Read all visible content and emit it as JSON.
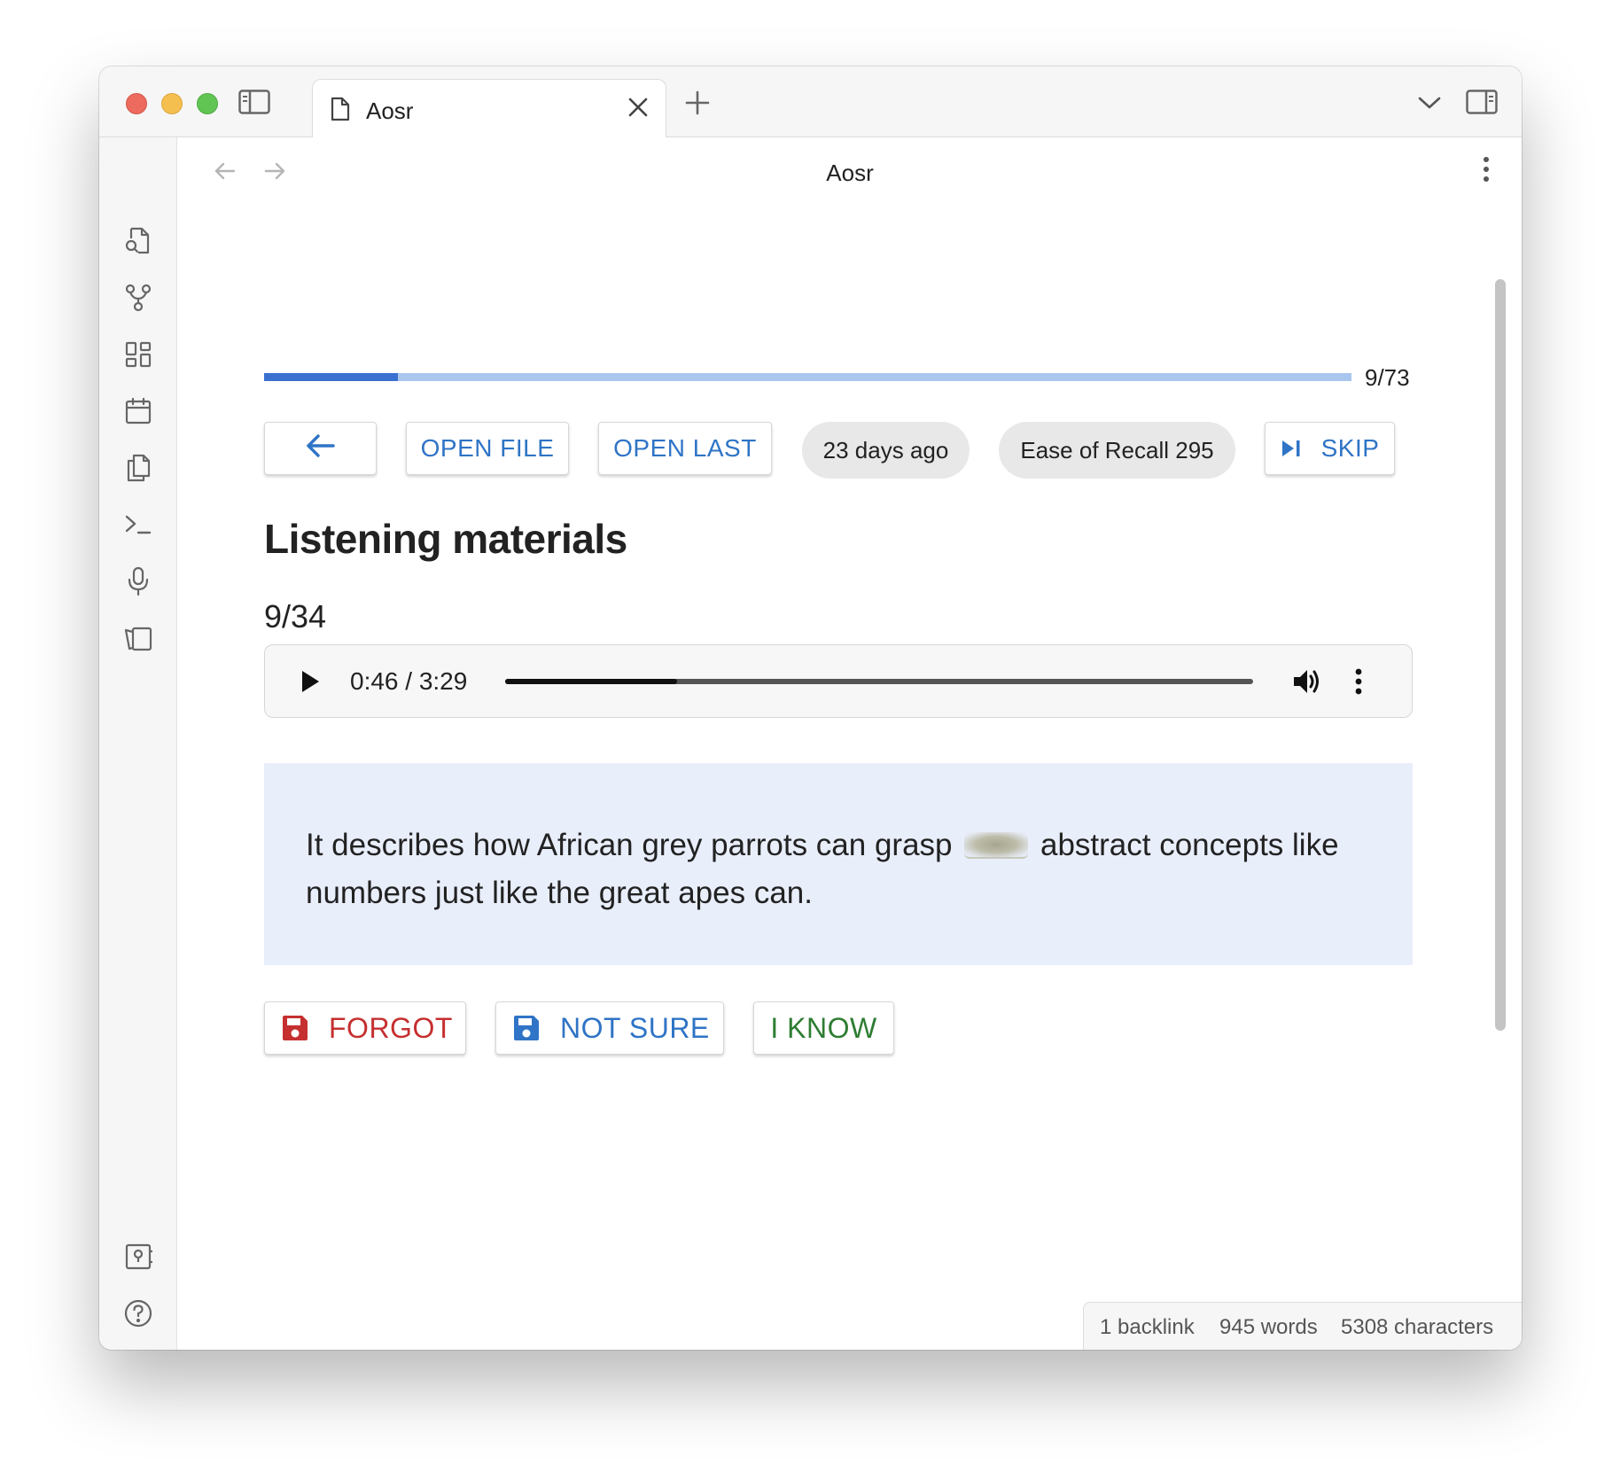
{
  "window": {
    "tab_title": "Aosr",
    "view_title": "Aosr"
  },
  "progress": {
    "current": 9,
    "total": 73,
    "label": "9/73",
    "fraction": 0.123
  },
  "toolbar": {
    "open_file": "OPEN FILE",
    "open_last": "OPEN LAST",
    "age_chip": "23 days ago",
    "ease_chip": "Ease of Recall 295",
    "skip": "SKIP"
  },
  "card": {
    "heading": "Listening materials",
    "counter": "9/34",
    "audio": {
      "time": "0:46 / 3:29",
      "played_fraction": 0.23
    },
    "text_before": "It describes how African grey parrots can grasp",
    "text_after": "abstract concepts like numbers just like the great apes can."
  },
  "responses": {
    "forgot": "FORGOT",
    "not_sure": "NOT SURE",
    "i_know": "I KNOW"
  },
  "status": {
    "backlinks": "1 backlink",
    "words": "945 words",
    "characters": "5308 characters"
  },
  "colors": {
    "accent": "#2f74c6",
    "progress_fill": "#3a70d0",
    "progress_track": "#a9c6ee",
    "forgot": "#c62f2f",
    "not_sure": "#2f74c6",
    "i_know": "#2e7d32",
    "card_bg": "#e9eefb"
  },
  "icons": {
    "ribbon_top": [
      "file-search-icon",
      "graph-icon",
      "dashboard-icon",
      "calendar-icon",
      "copy-icon",
      "terminal-icon",
      "microphone-icon",
      "cards-icon"
    ],
    "ribbon_bottom": [
      "vault-icon",
      "help-icon",
      "settings-icon"
    ]
  }
}
